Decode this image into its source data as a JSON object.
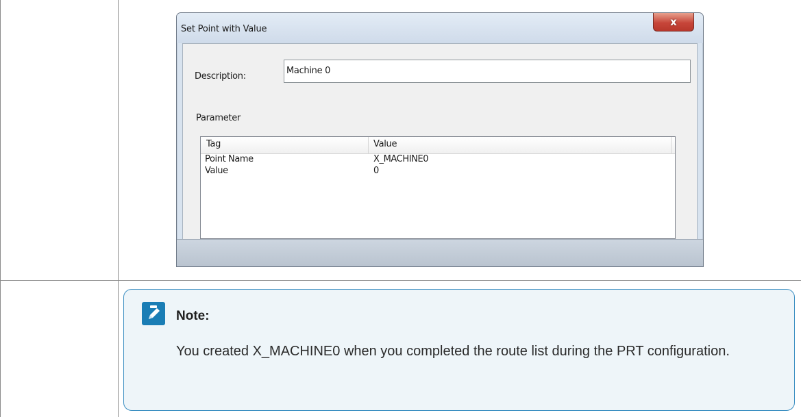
{
  "dialog": {
    "title": "Set Point with Value",
    "close_label": "x",
    "description_label": "Description:",
    "description_value": "Machine 0",
    "parameter_label": "Parameter",
    "columns": [
      "Tag",
      "Value"
    ],
    "rows": [
      {
        "tag": "Point Name",
        "value": "X_MACHINE0"
      },
      {
        "tag": "Value",
        "value": "0"
      }
    ]
  },
  "note": {
    "icon": "pencil-icon",
    "title": "Note:",
    "text": "You created X_MACHINE0 when you completed the route list during the PRT configuration."
  },
  "colors": {
    "note_border": "#3c8fc2",
    "note_background": "#eef5f9",
    "note_icon": "#1a7db5",
    "close_button": "#c7463a"
  }
}
